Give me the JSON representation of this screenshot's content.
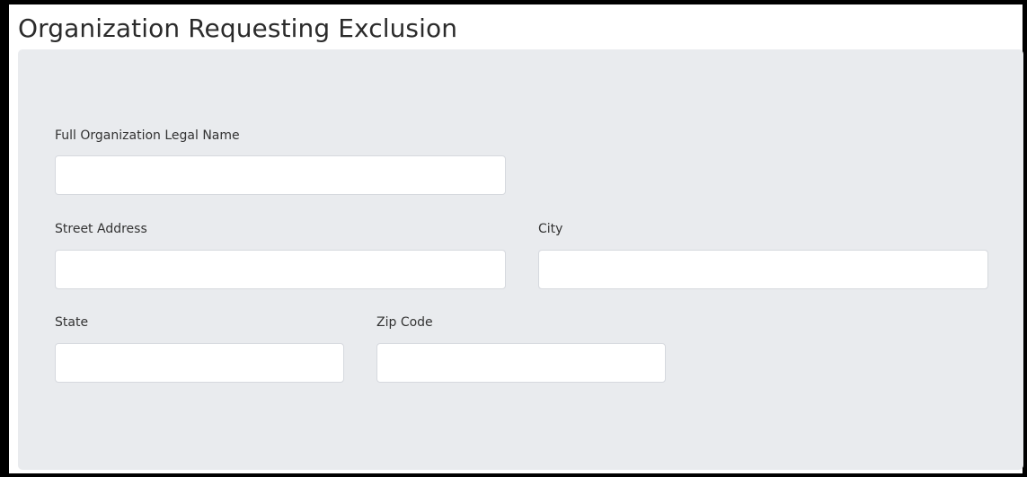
{
  "section": {
    "title": "Organization Requesting Exclusion"
  },
  "form": {
    "legal_name": {
      "label": "Full Organization Legal Name",
      "value": ""
    },
    "street_address": {
      "label": "Street Address",
      "value": ""
    },
    "city": {
      "label": "City",
      "value": ""
    },
    "state": {
      "label": "State",
      "value": ""
    },
    "zip_code": {
      "label": "Zip Code",
      "value": ""
    }
  },
  "colors": {
    "panel_background": "#e9ebee",
    "input_background": "#ffffff",
    "frame_border": "#000000",
    "heading_text": "#2b2b2b"
  }
}
